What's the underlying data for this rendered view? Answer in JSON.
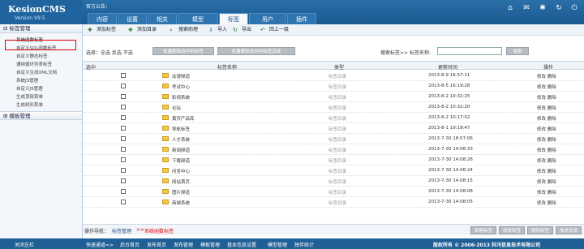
{
  "brand": {
    "name": "KesionCMS",
    "version": "Version V9.5"
  },
  "notice": "官方公告：",
  "tabs": [
    "内容",
    "设置",
    "相关",
    "模型",
    "标签",
    "用户",
    "插件"
  ],
  "sidebar": {
    "sec1": "标签管理",
    "items": [
      "系统函数标签",
      "自定义SQL函数标签",
      "自定义静态标签",
      "通用循环列表标签",
      "自定义生成XML文档",
      "系统JS管理",
      "自定义JS管理",
      "生成顶部菜单",
      "生成树形菜单"
    ],
    "sec2": "模板管理"
  },
  "toolbar": [
    "添加标签",
    "添加目录",
    "搜索助理",
    "导入",
    "导出",
    "回上一级"
  ],
  "selbar": {
    "label": "选择：全选  反选  不选",
    "btn1": "批量删除选中的标签",
    "btn2": "批量删除选中的标签目录",
    "search": "搜索标签>> 标签名称:",
    "search_btn": "搜索"
  },
  "headers": {
    "sel": "选中",
    "name": "标签名称",
    "type": "类型",
    "time": "更新时间",
    "op": "操作"
  },
  "rows": [
    {
      "name": "动漫频道",
      "type": "标签目录",
      "time": "2013-8-9 16:57:11",
      "op": "修改 删除"
    },
    {
      "name": "考试中心",
      "type": "标签目录",
      "time": "2013-8-5 16:19:28",
      "op": "修改 删除"
    },
    {
      "name": "影视系统",
      "type": "标签目录",
      "time": "2013-8-2 10:32:25",
      "op": "修改 删除"
    },
    {
      "name": "论坛",
      "type": "标签目录",
      "time": "2013-8-2 10:32:20",
      "op": "修改 删除"
    },
    {
      "name": "黄页产品库",
      "type": "标签目录",
      "time": "2013-8-2 10:17:02",
      "op": "修改 删除"
    },
    {
      "name": "导航标签",
      "type": "标签目录",
      "time": "2013-8-1 19:18:47",
      "op": "修改 删除"
    },
    {
      "name": "人才系统",
      "type": "标签目录",
      "time": "2013-7-30 18:57:06",
      "op": "修改 删除"
    },
    {
      "name": "新闻频道",
      "type": "标签目录",
      "time": "2013-7-30 14:08:33",
      "op": "修改 删除"
    },
    {
      "name": "下载频道",
      "type": "标签目录",
      "time": "2013-7-30 14:08:26",
      "op": "修改 删除"
    },
    {
      "name": "问答中心",
      "type": "标签目录",
      "time": "2013-7-30 14:08:24",
      "op": "修改 删除"
    },
    {
      "name": "网站首页",
      "type": "标签目录",
      "time": "2013-7-30 14:08:15",
      "op": "修改 删除"
    },
    {
      "name": "图片频道",
      "type": "标签目录",
      "time": "2013-7-30 14:08:08",
      "op": "修改 删除"
    },
    {
      "name": "商城系统",
      "type": "标签目录",
      "time": "2013-7-30 14:08:05",
      "op": "修改 删除"
    }
  ],
  "bottomnav": {
    "label": "操作导航：",
    "l1": "标签管理",
    "sep": ">>",
    "l2": "系统函数标签"
  },
  "bottom_buttons": [
    "新建标签",
    "修改标签",
    "删除标签",
    "技术交流"
  ],
  "footer": {
    "close": "关闭左栏",
    "quick": "快速通道=>",
    "links": [
      "后台首页",
      "发布首页",
      "发布管理",
      "模板管理",
      "基本信息设置",
      "模型管理",
      "独伴统计"
    ],
    "copy": "版权所有 © 2006-2013 科汛信息技术有限公司"
  }
}
